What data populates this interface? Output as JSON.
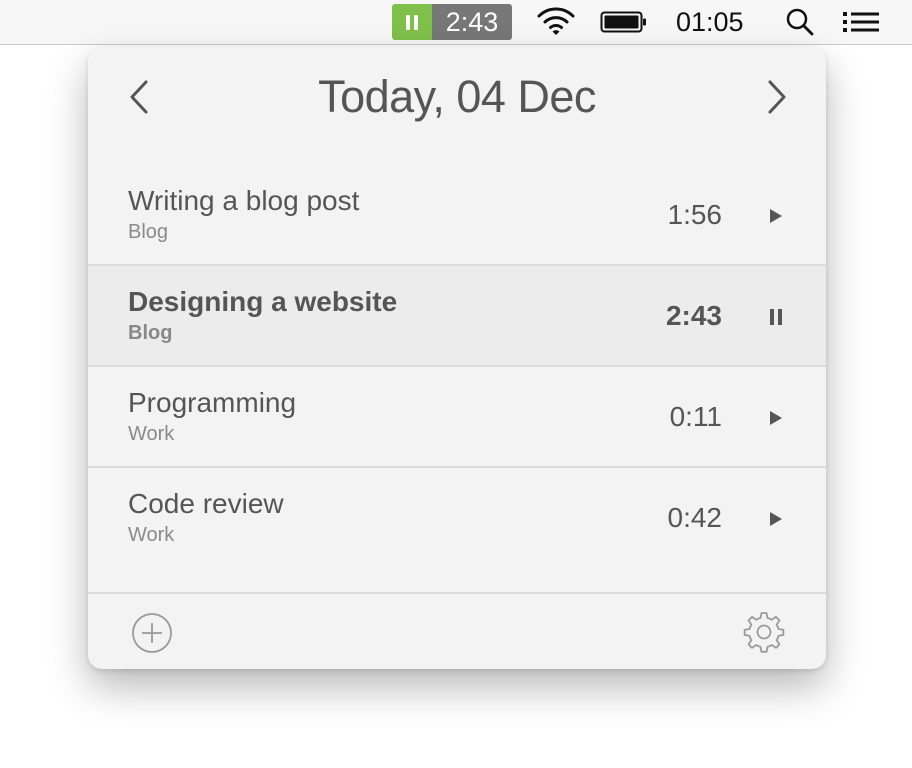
{
  "menubar": {
    "timer_time": "2:43",
    "clock": "01:05",
    "timer_badge_color": "#7fc04a"
  },
  "popover": {
    "title": "Today, 04 Dec",
    "tasks": [
      {
        "name": "Writing a blog post",
        "project": "Blog",
        "time": "1:56",
        "state": "stopped"
      },
      {
        "name": "Designing a website",
        "project": "Blog",
        "time": "2:43",
        "state": "running"
      },
      {
        "name": "Programming",
        "project": "Work",
        "time": "0:11",
        "state": "stopped"
      },
      {
        "name": "Code review",
        "project": "Work",
        "time": "0:42",
        "state": "stopped"
      }
    ]
  }
}
